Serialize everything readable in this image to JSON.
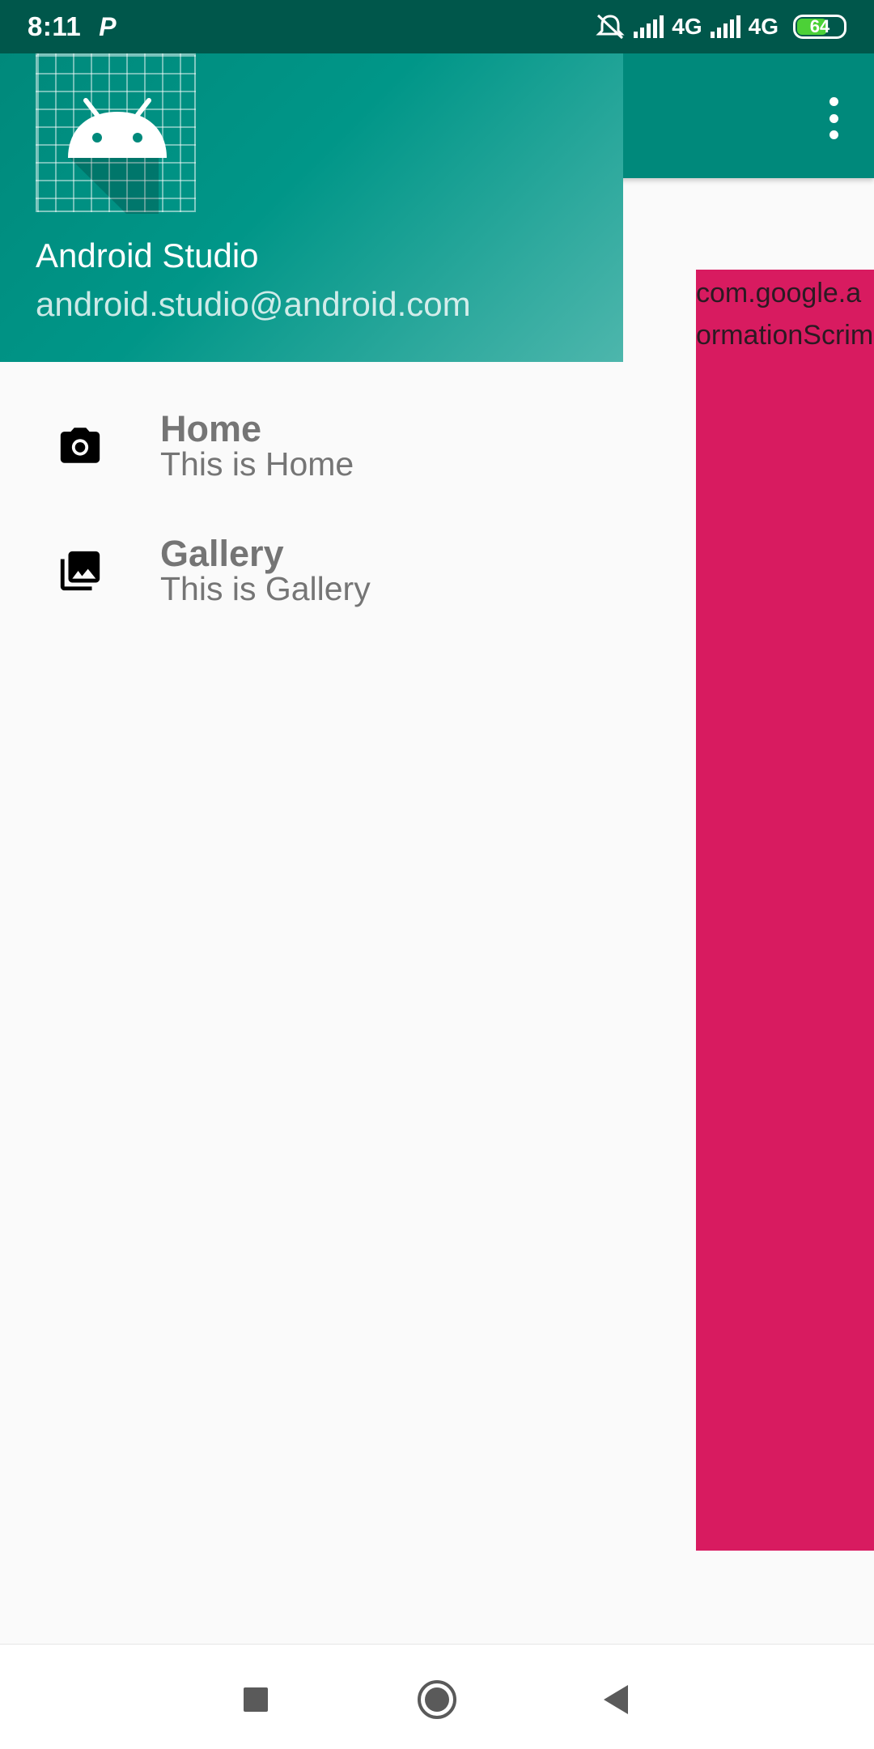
{
  "status_bar": {
    "time": "8:11",
    "app_indicator": "P",
    "network_1": "4G",
    "network_2": "4G",
    "battery_level": "64",
    "icons": [
      "mute-icon",
      "signal-icon",
      "signal-icon",
      "battery-icon"
    ]
  },
  "drawer": {
    "header": {
      "title": "Android Studio",
      "email": "android.studio@android.com"
    },
    "items": [
      {
        "title": "Home",
        "subtitle": "This is Home",
        "icon": "camera-icon"
      },
      {
        "title": "Gallery",
        "subtitle": "This is Gallery",
        "icon": "gallery-icon"
      }
    ]
  },
  "content": {
    "text_line_1": "com.google.a",
    "text_line_2": "ormationScrim"
  },
  "colors": {
    "primary": "#00897b",
    "primary_dark": "#00574b",
    "accent_block": "#d81b60"
  }
}
